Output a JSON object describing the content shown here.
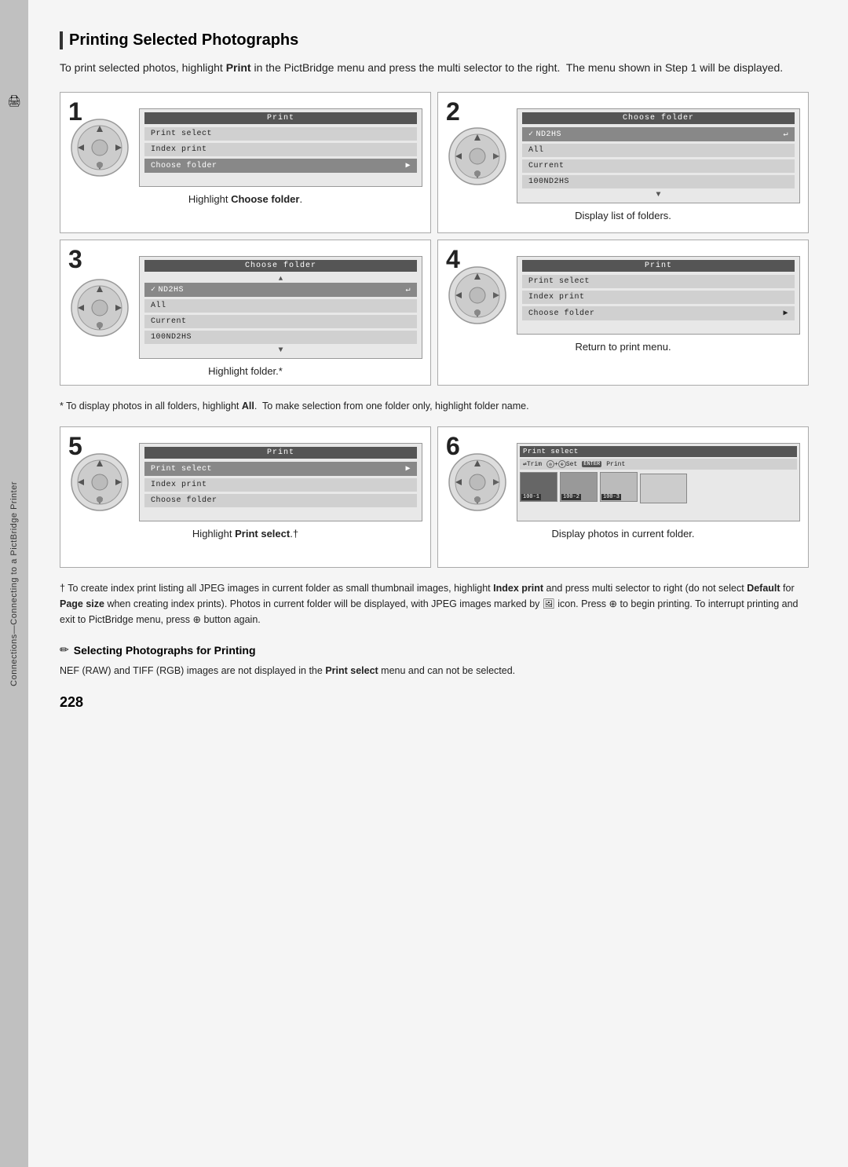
{
  "sidebar": {
    "icon": "🖨",
    "text": "Connections—Connecting to a PictBridge Printer"
  },
  "page": {
    "title": "Printing Selected Photographs",
    "intro": "To print selected photos, highlight Print in the PictBridge menu and press the multi selector to the right.  The menu shown in Step 1 will be displayed.",
    "intro_bold": "Print",
    "steps": [
      {
        "number": "1",
        "caption": "Highlight Choose folder.",
        "caption_bold": "Choose folder",
        "menu_title": "Print",
        "menu_items": [
          "Print select",
          "Index print",
          "Choose folder"
        ],
        "highlighted_item": 2
      },
      {
        "number": "2",
        "caption": "Display list of folders.",
        "menu_title": "Choose folder",
        "menu_items": [
          "✓ND2HS",
          "All",
          "Current",
          "100ND2HS"
        ],
        "highlighted_item": 0
      },
      {
        "number": "3",
        "caption": "Highlight folder.*",
        "menu_title": "Choose folder",
        "menu_items": [
          "✓ND2HS",
          "All",
          "Current",
          "100ND2HS"
        ],
        "highlighted_item": 0
      },
      {
        "number": "4",
        "caption": "Return to print menu.",
        "menu_title": "Print",
        "menu_items": [
          "Print select",
          "Index print",
          "Choose folder"
        ],
        "highlighted_item": -1
      },
      {
        "number": "5",
        "caption": "Highlight Print select.",
        "caption_bold": "Print select",
        "menu_title": "Print",
        "menu_items": [
          "Print select",
          "Index print",
          "Choose folder"
        ],
        "highlighted_item": 0
      },
      {
        "number": "6",
        "caption": "Display photos in current folder.",
        "menu_title": "Print select",
        "photo_labels": [
          "100-1",
          "100-2",
          "100-3"
        ]
      }
    ],
    "note1": "* To display photos in all folders, highlight All.  To make selection from one folder only, highlight folder name.",
    "note1_bold": "All",
    "note2_dagger": "† To create index print listing all JPEG images in current folder as small thumbnail images, highlight Index print and press multi selector to right (do not select Default for Page size when creating index prints). Photos in current folder will be displayed, with JPEG images marked by 🖼 icon. Press ⊕ to begin printing. To interrupt printing and exit to PictBridge menu, press ⊕ button again.",
    "note2_bolds": [
      "Index print",
      "Default",
      "Page size"
    ],
    "selecting_header": "Selecting Photographs for Printing",
    "selecting_body": "NEF (RAW) and TIFF (RGB) images are not displayed in the Print select menu and can not be selected.",
    "selecting_body_bold": "Print select",
    "page_number": "228"
  }
}
